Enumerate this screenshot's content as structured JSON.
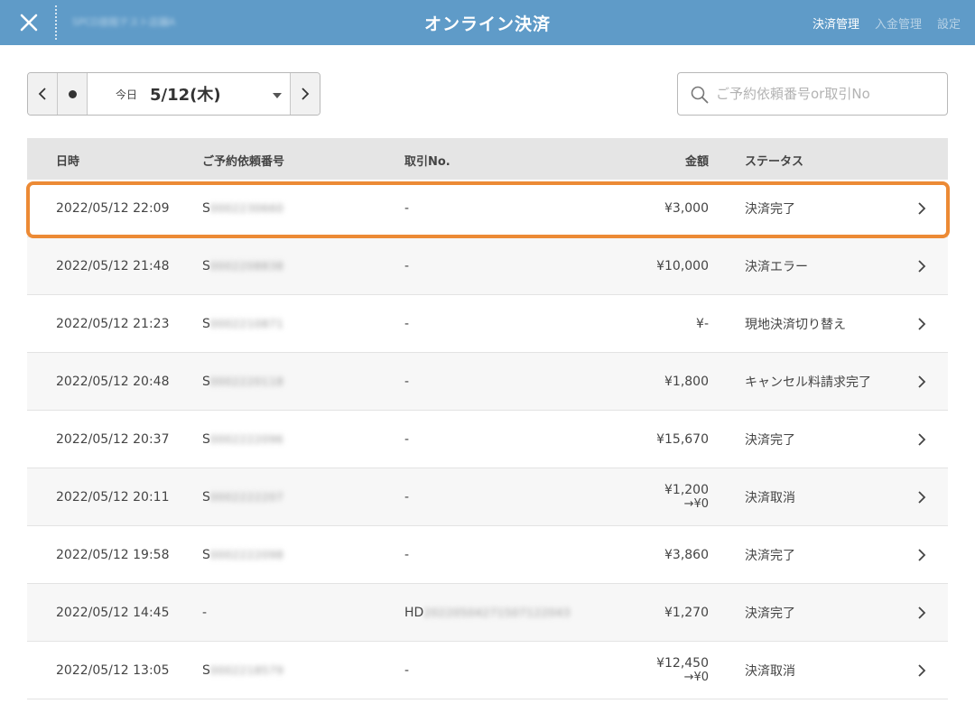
{
  "header": {
    "shop_name": "SPCD旅館テスト店舗A",
    "title": "オンライン決済",
    "nav": [
      {
        "label": "決済管理",
        "active": true
      },
      {
        "label": "入金管理",
        "active": false
      },
      {
        "label": "設定",
        "active": false
      }
    ]
  },
  "date_control": {
    "today_label": "今日",
    "date": "5/12(木)"
  },
  "search": {
    "placeholder": "ご予約依頼番号or取引No"
  },
  "table": {
    "columns": {
      "datetime": "日時",
      "reservation": "ご予約依頼番号",
      "transaction": "取引No.",
      "amount": "金額",
      "status": "ステータス"
    },
    "rows": [
      {
        "datetime": "2022/05/12 22:09",
        "res_prefix": "S",
        "res_hidden": "0002230660",
        "tx_prefix": "-",
        "tx_hidden": "",
        "amount": "¥3,000",
        "amount_sub": "",
        "status": "決済完了"
      },
      {
        "datetime": "2022/05/12 21:48",
        "res_prefix": "S",
        "res_hidden": "0002208838",
        "tx_prefix": "-",
        "tx_hidden": "",
        "amount": "¥10,000",
        "amount_sub": "",
        "status": "決済エラー"
      },
      {
        "datetime": "2022/05/12 21:23",
        "res_prefix": "S",
        "res_hidden": "0002210871",
        "tx_prefix": "-",
        "tx_hidden": "",
        "amount": "¥-",
        "amount_sub": "",
        "status": "現地決済切り替え"
      },
      {
        "datetime": "2022/05/12 20:48",
        "res_prefix": "S",
        "res_hidden": "0002220118",
        "tx_prefix": "-",
        "tx_hidden": "",
        "amount": "¥1,800",
        "amount_sub": "",
        "status": "キャンセル料請求完了"
      },
      {
        "datetime": "2022/05/12 20:37",
        "res_prefix": "S",
        "res_hidden": "0002222096",
        "tx_prefix": "-",
        "tx_hidden": "",
        "amount": "¥15,670",
        "amount_sub": "",
        "status": "決済完了"
      },
      {
        "datetime": "2022/05/12 20:11",
        "res_prefix": "S",
        "res_hidden": "0002222207",
        "tx_prefix": "-",
        "tx_hidden": "",
        "amount": "¥1,200",
        "amount_sub": "→¥0",
        "status": "決済取消"
      },
      {
        "datetime": "2022/05/12 19:58",
        "res_prefix": "S",
        "res_hidden": "0002222098",
        "tx_prefix": "-",
        "tx_hidden": "",
        "amount": "¥3,860",
        "amount_sub": "",
        "status": "決済完了"
      },
      {
        "datetime": "2022/05/12 14:45",
        "res_prefix": "-",
        "res_hidden": "",
        "tx_prefix": "HD",
        "tx_hidden": "20220504271507122043",
        "amount": "¥1,270",
        "amount_sub": "",
        "status": "決済完了"
      },
      {
        "datetime": "2022/05/12 13:05",
        "res_prefix": "S",
        "res_hidden": "0002218579",
        "tx_prefix": "-",
        "tx_hidden": "",
        "amount": "¥12,450",
        "amount_sub": "→¥0",
        "status": "決済取消"
      }
    ]
  },
  "highlight_color": "#ec8a35",
  "header_color": "#5f9bc8"
}
